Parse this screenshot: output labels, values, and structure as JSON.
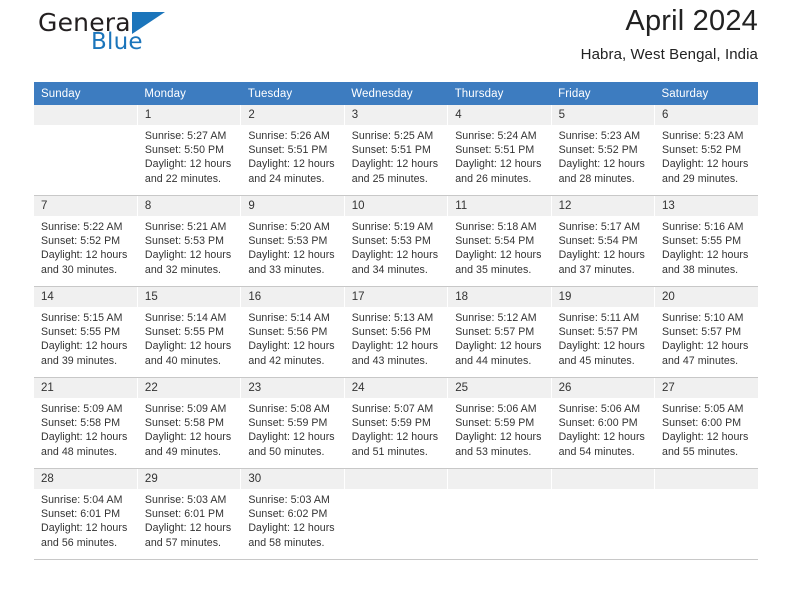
{
  "brand": {
    "name_part1": "General",
    "name_part2": "Blue",
    "triangle_icon": "triangle-icon",
    "accent_color": "#1b75bb"
  },
  "header": {
    "title": "April 2024",
    "subtitle": "Habra, West Bengal, India"
  },
  "calendar": {
    "header_color": "#3d7cc0",
    "daynum_background": "#f0f0f0",
    "weekdays": [
      "Sunday",
      "Monday",
      "Tuesday",
      "Wednesday",
      "Thursday",
      "Friday",
      "Saturday"
    ],
    "weeks": [
      [
        {
          "day": "",
          "lines": []
        },
        {
          "day": "1",
          "lines": [
            "Sunrise: 5:27 AM",
            "Sunset: 5:50 PM",
            "Daylight: 12 hours",
            "and 22 minutes."
          ]
        },
        {
          "day": "2",
          "lines": [
            "Sunrise: 5:26 AM",
            "Sunset: 5:51 PM",
            "Daylight: 12 hours",
            "and 24 minutes."
          ]
        },
        {
          "day": "3",
          "lines": [
            "Sunrise: 5:25 AM",
            "Sunset: 5:51 PM",
            "Daylight: 12 hours",
            "and 25 minutes."
          ]
        },
        {
          "day": "4",
          "lines": [
            "Sunrise: 5:24 AM",
            "Sunset: 5:51 PM",
            "Daylight: 12 hours",
            "and 26 minutes."
          ]
        },
        {
          "day": "5",
          "lines": [
            "Sunrise: 5:23 AM",
            "Sunset: 5:52 PM",
            "Daylight: 12 hours",
            "and 28 minutes."
          ]
        },
        {
          "day": "6",
          "lines": [
            "Sunrise: 5:23 AM",
            "Sunset: 5:52 PM",
            "Daylight: 12 hours",
            "and 29 minutes."
          ]
        }
      ],
      [
        {
          "day": "7",
          "lines": [
            "Sunrise: 5:22 AM",
            "Sunset: 5:52 PM",
            "Daylight: 12 hours",
            "and 30 minutes."
          ]
        },
        {
          "day": "8",
          "lines": [
            "Sunrise: 5:21 AM",
            "Sunset: 5:53 PM",
            "Daylight: 12 hours",
            "and 32 minutes."
          ]
        },
        {
          "day": "9",
          "lines": [
            "Sunrise: 5:20 AM",
            "Sunset: 5:53 PM",
            "Daylight: 12 hours",
            "and 33 minutes."
          ]
        },
        {
          "day": "10",
          "lines": [
            "Sunrise: 5:19 AM",
            "Sunset: 5:53 PM",
            "Daylight: 12 hours",
            "and 34 minutes."
          ]
        },
        {
          "day": "11",
          "lines": [
            "Sunrise: 5:18 AM",
            "Sunset: 5:54 PM",
            "Daylight: 12 hours",
            "and 35 minutes."
          ]
        },
        {
          "day": "12",
          "lines": [
            "Sunrise: 5:17 AM",
            "Sunset: 5:54 PM",
            "Daylight: 12 hours",
            "and 37 minutes."
          ]
        },
        {
          "day": "13",
          "lines": [
            "Sunrise: 5:16 AM",
            "Sunset: 5:55 PM",
            "Daylight: 12 hours",
            "and 38 minutes."
          ]
        }
      ],
      [
        {
          "day": "14",
          "lines": [
            "Sunrise: 5:15 AM",
            "Sunset: 5:55 PM",
            "Daylight: 12 hours",
            "and 39 minutes."
          ]
        },
        {
          "day": "15",
          "lines": [
            "Sunrise: 5:14 AM",
            "Sunset: 5:55 PM",
            "Daylight: 12 hours",
            "and 40 minutes."
          ]
        },
        {
          "day": "16",
          "lines": [
            "Sunrise: 5:14 AM",
            "Sunset: 5:56 PM",
            "Daylight: 12 hours",
            "and 42 minutes."
          ]
        },
        {
          "day": "17",
          "lines": [
            "Sunrise: 5:13 AM",
            "Sunset: 5:56 PM",
            "Daylight: 12 hours",
            "and 43 minutes."
          ]
        },
        {
          "day": "18",
          "lines": [
            "Sunrise: 5:12 AM",
            "Sunset: 5:57 PM",
            "Daylight: 12 hours",
            "and 44 minutes."
          ]
        },
        {
          "day": "19",
          "lines": [
            "Sunrise: 5:11 AM",
            "Sunset: 5:57 PM",
            "Daylight: 12 hours",
            "and 45 minutes."
          ]
        },
        {
          "day": "20",
          "lines": [
            "Sunrise: 5:10 AM",
            "Sunset: 5:57 PM",
            "Daylight: 12 hours",
            "and 47 minutes."
          ]
        }
      ],
      [
        {
          "day": "21",
          "lines": [
            "Sunrise: 5:09 AM",
            "Sunset: 5:58 PM",
            "Daylight: 12 hours",
            "and 48 minutes."
          ]
        },
        {
          "day": "22",
          "lines": [
            "Sunrise: 5:09 AM",
            "Sunset: 5:58 PM",
            "Daylight: 12 hours",
            "and 49 minutes."
          ]
        },
        {
          "day": "23",
          "lines": [
            "Sunrise: 5:08 AM",
            "Sunset: 5:59 PM",
            "Daylight: 12 hours",
            "and 50 minutes."
          ]
        },
        {
          "day": "24",
          "lines": [
            "Sunrise: 5:07 AM",
            "Sunset: 5:59 PM",
            "Daylight: 12 hours",
            "and 51 minutes."
          ]
        },
        {
          "day": "25",
          "lines": [
            "Sunrise: 5:06 AM",
            "Sunset: 5:59 PM",
            "Daylight: 12 hours",
            "and 53 minutes."
          ]
        },
        {
          "day": "26",
          "lines": [
            "Sunrise: 5:06 AM",
            "Sunset: 6:00 PM",
            "Daylight: 12 hours",
            "and 54 minutes."
          ]
        },
        {
          "day": "27",
          "lines": [
            "Sunrise: 5:05 AM",
            "Sunset: 6:00 PM",
            "Daylight: 12 hours",
            "and 55 minutes."
          ]
        }
      ],
      [
        {
          "day": "28",
          "lines": [
            "Sunrise: 5:04 AM",
            "Sunset: 6:01 PM",
            "Daylight: 12 hours",
            "and 56 minutes."
          ]
        },
        {
          "day": "29",
          "lines": [
            "Sunrise: 5:03 AM",
            "Sunset: 6:01 PM",
            "Daylight: 12 hours",
            "and 57 minutes."
          ]
        },
        {
          "day": "30",
          "lines": [
            "Sunrise: 5:03 AM",
            "Sunset: 6:02 PM",
            "Daylight: 12 hours",
            "and 58 minutes."
          ]
        },
        {
          "day": "",
          "lines": []
        },
        {
          "day": "",
          "lines": []
        },
        {
          "day": "",
          "lines": []
        },
        {
          "day": "",
          "lines": []
        }
      ]
    ]
  }
}
